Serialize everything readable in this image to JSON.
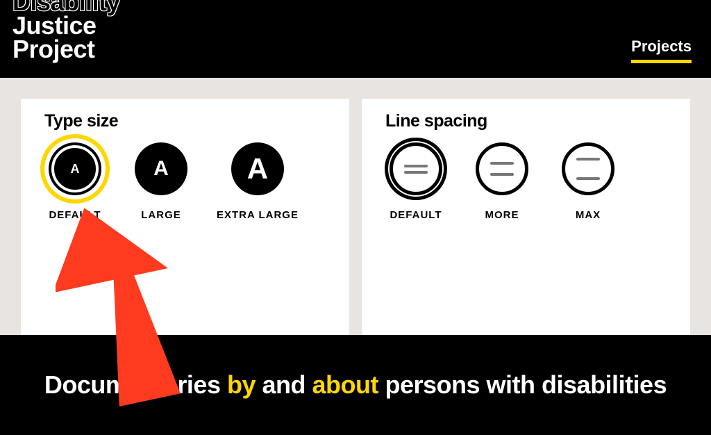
{
  "header": {
    "logo_line1": "Disability",
    "logo_line2": "Justice",
    "logo_line3": "Project",
    "nav_projects": "Projects"
  },
  "type_size": {
    "title": "Type size",
    "options": [
      {
        "glyph": "A",
        "label": "DEFAULT",
        "size": "sm",
        "selected": true
      },
      {
        "glyph": "A",
        "label": "LARGE",
        "size": "md",
        "selected": false
      },
      {
        "glyph": "A",
        "label": "EXTRA LARGE",
        "size": "lg",
        "selected": false
      }
    ]
  },
  "line_spacing": {
    "title": "Line spacing",
    "options": [
      {
        "label": "DEFAULT",
        "spacing": "default",
        "selected": true
      },
      {
        "label": "MORE",
        "spacing": "more",
        "selected": false
      },
      {
        "label": "MAX",
        "spacing": "max",
        "selected": false
      }
    ]
  },
  "tagline": {
    "p1": "Documentaries ",
    "hl1": "by",
    "p2": " and ",
    "hl2": "about",
    "p3": " persons with disabilities"
  },
  "colors": {
    "accent": "#ffd600",
    "annotation_arrow": "#ff3b1f"
  }
}
